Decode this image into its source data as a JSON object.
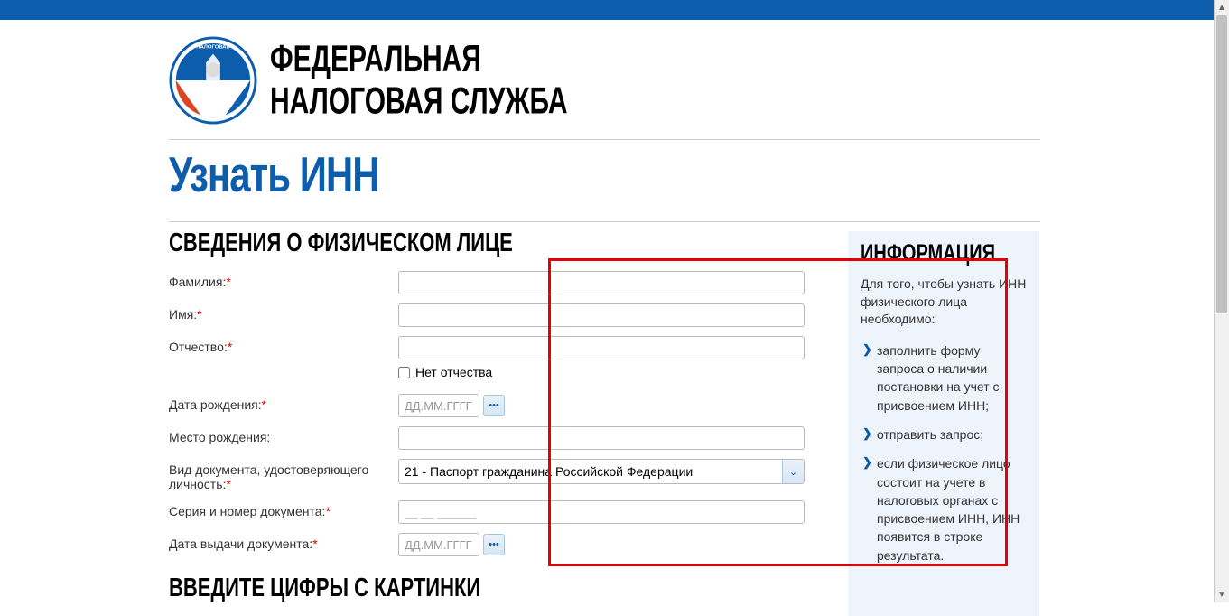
{
  "header": {
    "org_line1": "ФЕДЕРАЛЬНАЯ",
    "org_line2": "НАЛОГОВАЯ СЛУЖБА"
  },
  "page_title": "Узнать ИНН",
  "section1_title": "СВЕДЕНИЯ О ФИЗИЧЕСКОМ ЛИЦЕ",
  "section2_title": "ВВЕДИТЕ ЦИФРЫ С КАРТИНКИ",
  "form": {
    "lastname_label": "Фамилия:",
    "firstname_label": "Имя:",
    "patronymic_label": "Отчество:",
    "no_patronymic": "Нет отчества",
    "birthdate_label": "Дата рождения:",
    "birthplace_label": "Место рождения:",
    "doctype_label": "Вид документа, удостоверяющего личность:",
    "doctype_value": "21 - Паспорт гражданина Российской Федерации",
    "docseries_label": "Серия и номер документа:",
    "docseries_placeholder": "__ __ ______",
    "docdate_label": "Дата выдачи документа:",
    "date_placeholder": "ДД.ММ.ГГГГ",
    "date_btn": "•••"
  },
  "info": {
    "title": "ИНФОРМАЦИЯ",
    "intro": "Для того, чтобы узнать ИНН физического лица необходимо:",
    "items": [
      "заполнить форму запроса о наличии постановки на учет с присвоением ИНН;",
      "отправить запрос;",
      "если физическое лицо состоит на учете в налоговых органах с присвоением ИНН, ИНН появится в строке результата."
    ]
  }
}
